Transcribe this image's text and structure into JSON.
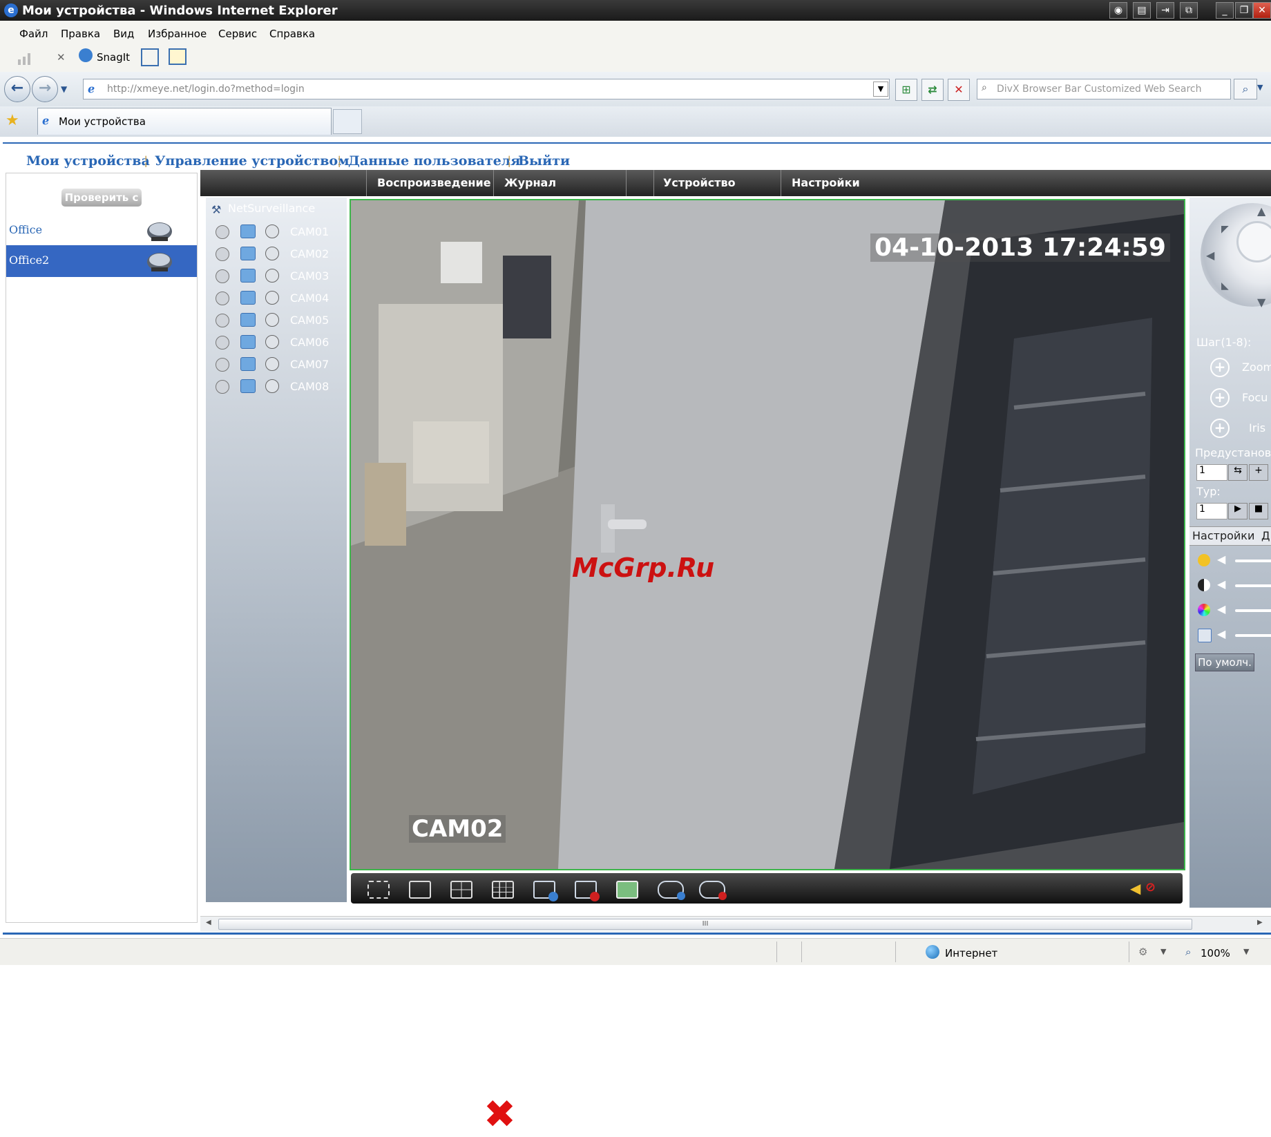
{
  "window": {
    "title": "Мои устройства - Windows Internet Explorer",
    "ie_icon": "e"
  },
  "menu": [
    "Файл",
    "Правка",
    "Вид",
    "Избранное",
    "Сервис",
    "Справка"
  ],
  "toolbar": {
    "snagit_label": "SnagIt"
  },
  "address": {
    "url": "http://xmeye.net/login.do?method=login",
    "search_placeholder": "DivX Browser Bar Customized Web Search"
  },
  "tab": {
    "title": "Мои устройства"
  },
  "toplinks": [
    "Мои устройства",
    "Управление устройством",
    "Данные пользователя",
    "Выйти"
  ],
  "left": {
    "check_button": "Проверить с",
    "devices": [
      {
        "name": "Office",
        "selected": false
      },
      {
        "name": "Office2",
        "selected": true
      }
    ]
  },
  "apptabs": [
    "Воспроизведение",
    "Журнал",
    "Устройство",
    "Настройки"
  ],
  "camtree": {
    "root": "NetSurveillance",
    "cameras": [
      "CAM01",
      "CAM02",
      "CAM03",
      "CAM04",
      "CAM05",
      "CAM06",
      "CAM07",
      "CAM08"
    ]
  },
  "video": {
    "timestamp": "04-10-2013 17:24:59",
    "channel_label": "CAM02",
    "watermark": "McGrp.Ru"
  },
  "ptz": {
    "step_label": "Шаг(1-8):",
    "zoom_label": "Zoom",
    "focus_label": "Focu",
    "iris_label": "Iris",
    "preset_label": "Предустанов",
    "preset_value": "1",
    "tour_label": "Тур:",
    "tour_value": "1",
    "settings_tab": "Настройки",
    "settings_tab2": "Д",
    "default_button": "По умолч."
  },
  "scrollbar": {
    "grip": "III"
  },
  "status": {
    "zone": "Интернет",
    "zoom": "100%"
  },
  "colors": {
    "link_blue": "#2a67b5",
    "selection_blue": "#3567c2",
    "video_border": "#3cb54a",
    "watermark_red": "#cc1111"
  }
}
